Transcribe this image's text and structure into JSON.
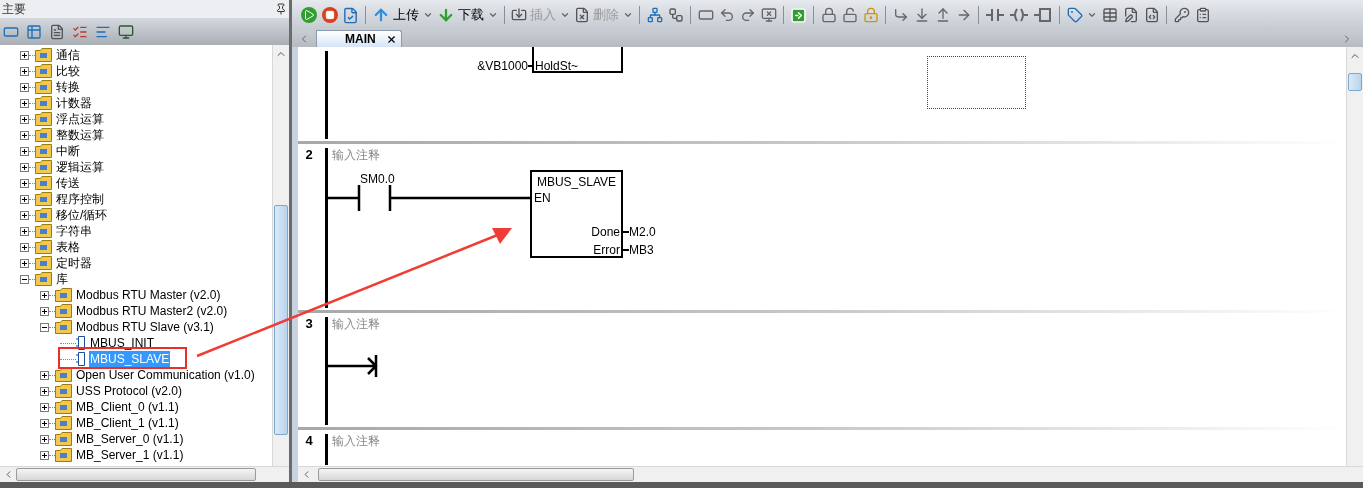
{
  "panel": {
    "title": "主要"
  },
  "tree": [
    {
      "label": "通信",
      "expanded": false,
      "selected": false
    },
    {
      "label": "比较",
      "expanded": false,
      "selected": false
    },
    {
      "label": "转换",
      "expanded": false,
      "selected": false
    },
    {
      "label": "计数器",
      "expanded": false,
      "selected": false
    },
    {
      "label": "浮点运算",
      "expanded": false,
      "selected": false
    },
    {
      "label": "整数运算",
      "expanded": false,
      "selected": false
    },
    {
      "label": "中断",
      "expanded": false,
      "selected": false
    },
    {
      "label": "逻辑运算",
      "expanded": false,
      "selected": false
    },
    {
      "label": "传送",
      "expanded": false,
      "selected": false
    },
    {
      "label": "程序控制",
      "expanded": false,
      "selected": false
    },
    {
      "label": "移位/循环",
      "expanded": false,
      "selected": false
    },
    {
      "label": "字符串",
      "expanded": false,
      "selected": false
    },
    {
      "label": "表格",
      "expanded": false,
      "selected": false
    },
    {
      "label": "定时器",
      "expanded": false,
      "selected": false
    },
    {
      "label": "库",
      "expanded": true,
      "selected": false,
      "children": [
        {
          "label": "Modbus RTU Master (v2.0)",
          "expanded": false,
          "selected": false
        },
        {
          "label": "Modbus RTU Master2 (v2.0)",
          "expanded": false,
          "selected": false
        },
        {
          "label": "Modbus RTU Slave (v3.1)",
          "expanded": true,
          "selected": false,
          "children": [
            {
              "label": "MBUS_INIT",
              "selected": false
            },
            {
              "label": "MBUS_SLAVE",
              "selected": true
            }
          ]
        },
        {
          "label": "Open User Communication (v1.0)",
          "expanded": false,
          "selected": false
        },
        {
          "label": "USS Protocol (v2.0)",
          "expanded": false,
          "selected": false
        },
        {
          "label": "MB_Client_0 (v1.1)",
          "expanded": false,
          "selected": false
        },
        {
          "label": "MB_Client_1 (v1.1)",
          "expanded": false,
          "selected": false
        },
        {
          "label": "MB_Server_0 (v1.1)",
          "expanded": false,
          "selected": false
        },
        {
          "label": "MB_Server_1 (v1.1)",
          "expanded": false,
          "selected": false
        }
      ]
    }
  ],
  "toolbar": {
    "buttons": [
      {
        "label": "上传",
        "disabled": false
      },
      {
        "label": "下载",
        "disabled": false
      },
      {
        "label": "插入",
        "disabled": true
      },
      {
        "label": "删除",
        "disabled": true
      }
    ]
  },
  "tabs": [
    {
      "label": "MAIN",
      "selected": true
    }
  ],
  "networks": [
    {
      "kind": "box_tail",
      "inputs": [
        {
          "operand": "&VB1000",
          "pin": "HoldSt~"
        }
      ]
    },
    {
      "kind": "box",
      "number": "2",
      "comment": "输入注释",
      "contact": "SM0.0",
      "box": {
        "title": "MBUS_SLAVE",
        "input": "EN",
        "outputs": [
          {
            "pin": "Done",
            "operand": "M2.0"
          },
          {
            "pin": "Error",
            "operand": "MB3"
          }
        ]
      }
    },
    {
      "kind": "open_rung",
      "number": "3",
      "comment": "输入注释"
    },
    {
      "kind": "comment_only",
      "number": "4",
      "comment": "输入注释"
    }
  ]
}
